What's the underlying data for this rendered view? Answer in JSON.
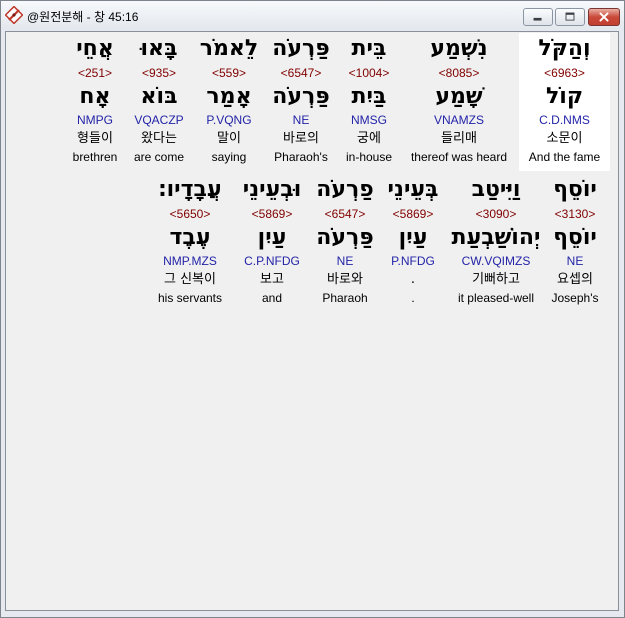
{
  "window": {
    "title": "@원전분해 - 창 45:16",
    "icon": "app-icon",
    "controls": {
      "minimize": "minimize-icon",
      "maximize": "maximize-icon",
      "close": "close-icon"
    }
  },
  "colors": {
    "strong_number": "#800000",
    "morphology": "#2323a8",
    "selection_background": "#ffffff",
    "close_button": "#c94a3a"
  },
  "words": [
    {
      "hebrew": "וְהַקֹּל",
      "strong": "<6963>",
      "lemma": "קוֹל",
      "morph": "C.D.NMS",
      "korean": "소문이",
      "english": "And the fame",
      "selected": true
    },
    {
      "hebrew": "נִשְׁמַע",
      "strong": "<8085>",
      "lemma": "שָׁמַע",
      "morph": "VNAMZS",
      "korean": "들리매",
      "english": "thereof was heard"
    },
    {
      "hebrew": "בֵּית",
      "strong": "<1004>",
      "lemma": "בַּיִת",
      "morph": "NMSG",
      "korean": "궁에",
      "english": "in-house"
    },
    {
      "hebrew": "פַּרְעֹה",
      "strong": "<6547>",
      "lemma": "פַּרְעֹה",
      "morph": "NE",
      "korean": "바로의",
      "english": "Pharaoh's"
    },
    {
      "hebrew": "לֵאמֹר",
      "strong": "<559>",
      "lemma": "אָמַר",
      "morph": "P.VQNG",
      "korean": "말이",
      "english": "saying"
    },
    {
      "hebrew": "בָּאוּ",
      "strong": "<935>",
      "lemma": "בּוֹא",
      "morph": "VQACZP",
      "korean": "왔다는",
      "english": "are come"
    },
    {
      "hebrew": "אֲחֵי",
      "strong": "<251>",
      "lemma": "אָח",
      "morph": "NMPG",
      "korean": "형들이",
      "english": "brethren"
    },
    {
      "hebrew": "יוֹסֵף",
      "strong": "<3130>",
      "lemma": "יוֹסֵף",
      "morph": "NE",
      "korean": "요셉의",
      "english": "Joseph's"
    },
    {
      "hebrew": "וַיִּיטַב",
      "strong": "<3090>",
      "lemma": "יְהוֹשַׁבְעַת",
      "morph": "CW.VQIMZS",
      "korean": "기뻐하고",
      "english": "it pleased-well"
    },
    {
      "hebrew": "בְּעֵינֵי",
      "strong": "<5869>",
      "lemma": "עַיִן",
      "morph": "P.NFDG",
      "korean": ".",
      "english": "."
    },
    {
      "hebrew": "פַרְעֹה",
      "strong": "<6547>",
      "lemma": "פַּרְעֹה",
      "morph": "NE",
      "korean": "바로와",
      "english": "Pharaoh"
    },
    {
      "hebrew": "וּבְעֵינֵי",
      "strong": "<5869>",
      "lemma": "עַיִן",
      "morph": "C.P.NFDG",
      "korean": "보고",
      "english": "and"
    },
    {
      "hebrew": "עֲבָדָיו׃",
      "strong": "<5650>",
      "lemma": "עֶבֶד",
      "morph": "NMP.MZS",
      "korean": "그 신복이",
      "english": "his servants"
    }
  ]
}
